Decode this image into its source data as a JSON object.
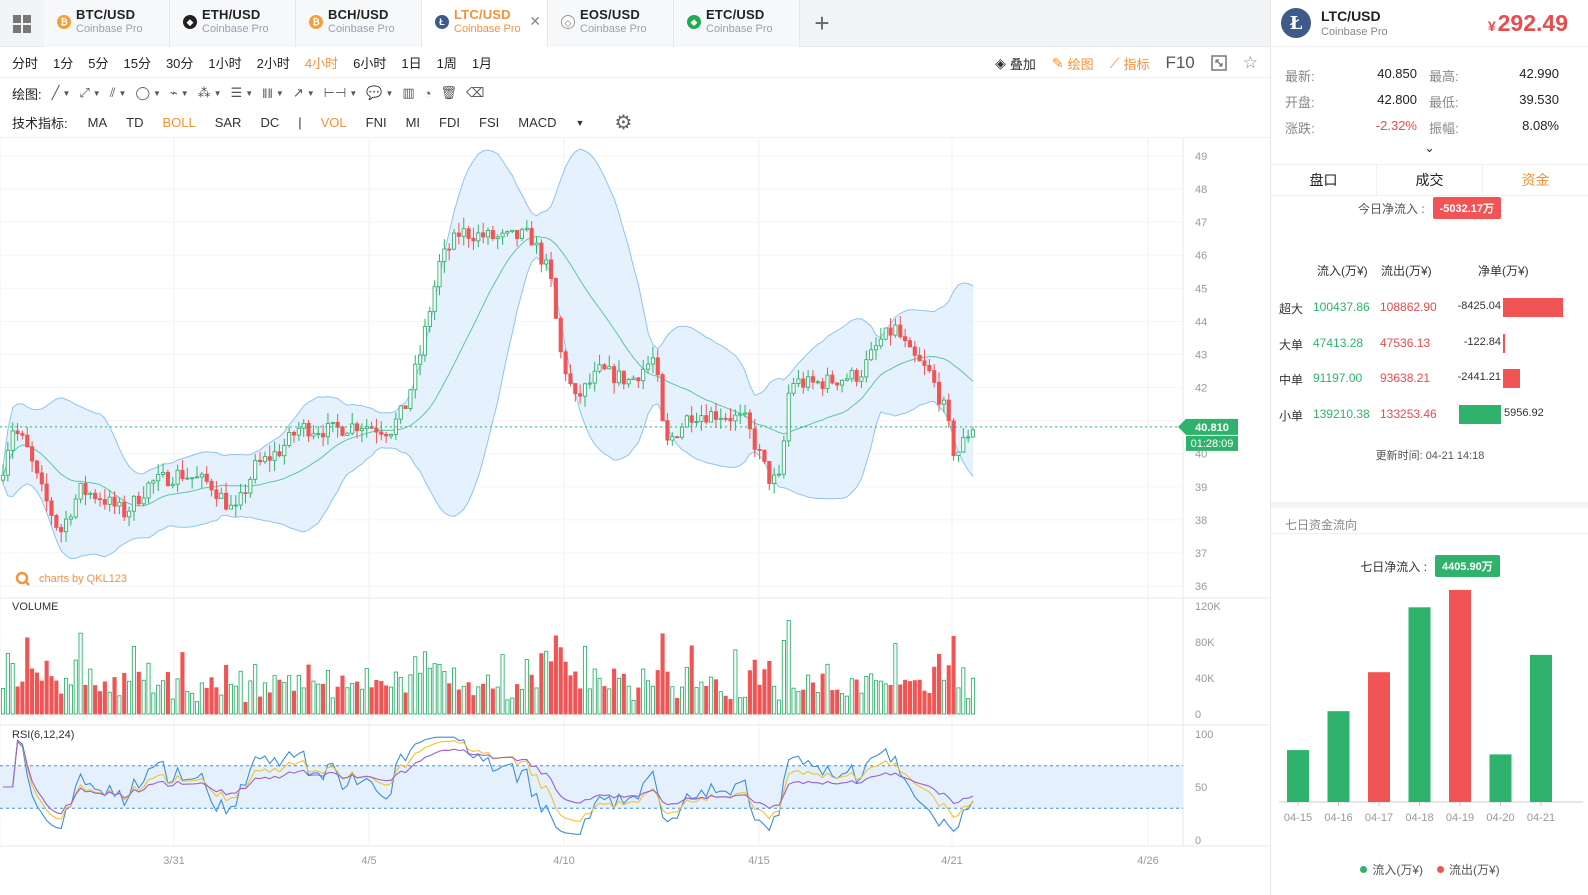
{
  "tabs": [
    {
      "symbol": "BTC/USD",
      "exchange": "Coinbase Pro",
      "icon": "bitcoin-icon",
      "color": "#f2a03a",
      "glyph": "₿"
    },
    {
      "symbol": "ETH/USD",
      "exchange": "Coinbase Pro",
      "icon": "ethereum-icon",
      "color": "#222222",
      "glyph": "◆"
    },
    {
      "symbol": "BCH/USD",
      "exchange": "Coinbase Pro",
      "icon": "bitcoin-cash-icon",
      "color": "#f2a03a",
      "glyph": "₿"
    },
    {
      "symbol": "LTC/USD",
      "exchange": "Coinbase Pro",
      "icon": "litecoin-icon",
      "color": "#3d5a8a",
      "glyph": "Ł",
      "active": true
    },
    {
      "symbol": "EOS/USD",
      "exchange": "Coinbase Pro",
      "icon": "eos-icon",
      "color": "#d0d4da",
      "glyph": "◇"
    },
    {
      "symbol": "ETC/USD",
      "exchange": "Coinbase Pro",
      "icon": "ethereum-classic-icon",
      "color": "#1fab52",
      "glyph": "◆"
    }
  ],
  "add_tab": "+",
  "intervals": [
    "分时",
    "1分",
    "5分",
    "15分",
    "30分",
    "1小时",
    "2小时",
    "4小时",
    "6小时",
    "1日",
    "1周",
    "1月"
  ],
  "active_interval": "4小时",
  "toolbar_right": {
    "overlay": "叠加",
    "draw": "绘图",
    "indicator": "指标",
    "f10": "F10"
  },
  "draw_label": "绘图:",
  "draw_tools": [
    "line-tool-icon",
    "ray-tool-icon",
    "channel-tool-icon",
    "circle-tool-icon",
    "zigzag-tool-icon",
    "pattern-tool-icon",
    "fib-tool-icon",
    "bars-tool-icon",
    "arrow-tool-icon",
    "range-tool-icon",
    "note-tool-icon"
  ],
  "indicator_label": "技术指标:",
  "indicators": [
    "MA",
    "TD",
    "BOLL",
    "SAR",
    "DC",
    "|",
    "VOL",
    "FNI",
    "MI",
    "FDI",
    "FSI",
    "MACD"
  ],
  "active_indicators": [
    "BOLL",
    "VOL"
  ],
  "chart": {
    "watermark": "charts by QKL123",
    "price_ticks": [
      49,
      48,
      47,
      46,
      45,
      44,
      43,
      42,
      41,
      40,
      39,
      38,
      37,
      36
    ],
    "price_range": [
      36,
      49
    ],
    "current_price": "40.810",
    "countdown": "01:28:09",
    "volume_label": "VOLUME",
    "volume_ticks": [
      "120K",
      "80K",
      "40K",
      "0"
    ],
    "rsi_label": "RSI(6,12,24)",
    "rsi_ticks": [
      "100",
      "50",
      "0"
    ],
    "date_ticks": [
      "3/31",
      "4/5",
      "4/10",
      "4/15",
      "4/21",
      "4/26"
    ],
    "colors": {
      "up": "#2fb36c",
      "down": "#f05454",
      "band": "#dcecfb",
      "band_line": "#8fc4ef",
      "mid": "#5fc6a5"
    }
  },
  "quote": {
    "symbol": "LTC/USD",
    "exchange": "Coinbase Pro",
    "currency": "¥",
    "price": "292.49",
    "stats": [
      [
        {
          "k": "最新:",
          "v": "40.850"
        },
        {
          "k": "最高:",
          "v": "42.990"
        }
      ],
      [
        {
          "k": "开盘:",
          "v": "42.800"
        },
        {
          "k": "最低:",
          "v": "39.530"
        }
      ],
      [
        {
          "k": "涨跌:",
          "v": "-2.32%",
          "red": true
        },
        {
          "k": "振幅:",
          "v": "8.08%"
        }
      ]
    ],
    "expand": "⌄"
  },
  "right_tabs": [
    "盘口",
    "成交",
    "资金"
  ],
  "active_right_tab": "资金",
  "today_flow": {
    "label": "今日净流入 :",
    "value": "-5032.17万"
  },
  "flow_headers": [
    "流入(万¥)",
    "流出(万¥)",
    "净单(万¥)"
  ],
  "flow_rows": [
    {
      "cat": "超大",
      "in": "100437.86",
      "out": "108862.90",
      "net": "-8425.04",
      "value": -8425.04
    },
    {
      "cat": "大单",
      "in": "47413.28",
      "out": "47536.13",
      "net": "-122.84",
      "value": -122.84
    },
    {
      "cat": "中单",
      "in": "91197.00",
      "out": "93638.21",
      "net": "-2441.21",
      "value": -2441.21
    },
    {
      "cat": "小单",
      "in": "139210.38",
      "out": "133253.46",
      "net": "5956.92",
      "value": 5956.92
    }
  ],
  "update_time": "更新时间:  04-21 14:18",
  "seven_title": "七日资金流向",
  "seven_net": {
    "label": "七日净流入 :",
    "value": "4405.90万"
  },
  "chart_data": {
    "type": "bar",
    "categories": [
      "04-15",
      "04-16",
      "04-17",
      "04-18",
      "04-19",
      "04-20",
      "04-21"
    ],
    "values": [
      1.2,
      2.1,
      3.0,
      4.5,
      4.9,
      1.1,
      3.4
    ],
    "directions": [
      "in",
      "in",
      "out",
      "in",
      "out",
      "in",
      "in"
    ],
    "legend": [
      "流入(万¥)",
      "流出(万¥)"
    ],
    "legend_position": "bottom"
  }
}
